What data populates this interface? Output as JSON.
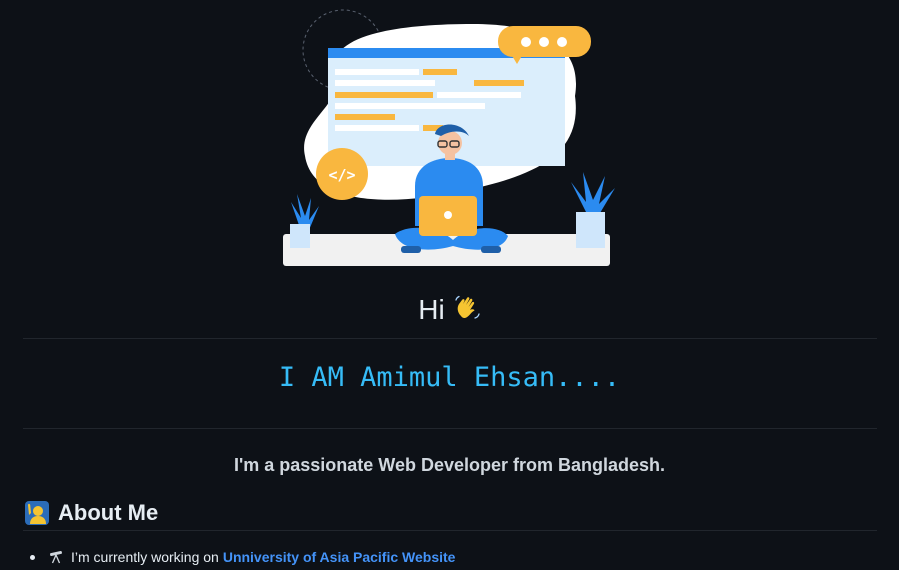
{
  "hero": {
    "code_badge": "</>"
  },
  "greeting": {
    "text": "Hi"
  },
  "typing_banner": {
    "text": "I AM Amimul Ehsan...."
  },
  "tagline": {
    "text": "I'm a passionate Web Developer from Bangladesh."
  },
  "about": {
    "heading": "About Me",
    "items": [
      {
        "prefix": "I’m currently working on",
        "link_text": "Unniversity of Asia Pacific Website"
      }
    ]
  },
  "colors": {
    "background": "#0d1117",
    "typing_text": "#36BCF7",
    "link": "#4493f8",
    "illustration_blue": "#2b8bf0",
    "illustration_yellow": "#f9b73f"
  }
}
